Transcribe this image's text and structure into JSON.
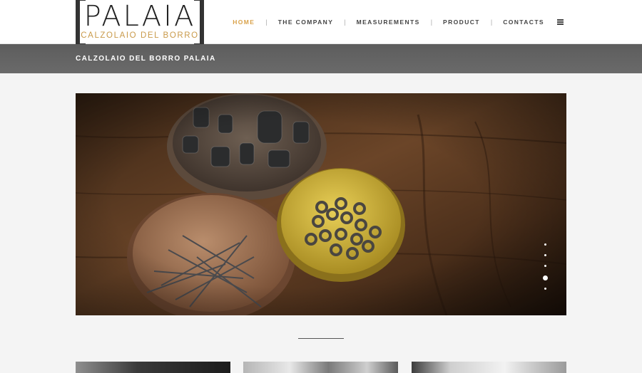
{
  "logo": {
    "title": "PALAIA",
    "subtitle": "CALZOLAIO DEL BORRO",
    "accent_color": "#c99a4a"
  },
  "nav": {
    "items": [
      {
        "label": "HOME",
        "active": true
      },
      {
        "label": "THE COMPANY",
        "active": false
      },
      {
        "label": "MEASUREMENTS",
        "active": false
      },
      {
        "label": "PRODUCT",
        "active": false
      },
      {
        "label": "CONTACTS",
        "active": false
      }
    ],
    "separator": "|",
    "menu_icon": "hamburger-menu-icon",
    "active_color": "#d9a24a"
  },
  "titlebar": {
    "text": "CALZOLAIO DEL BORRO PALAIA"
  },
  "slider": {
    "image": "bowls of shoemaker rivets, nails and eyelets on wooden table",
    "slide_count": 5,
    "active_slide": 4
  }
}
